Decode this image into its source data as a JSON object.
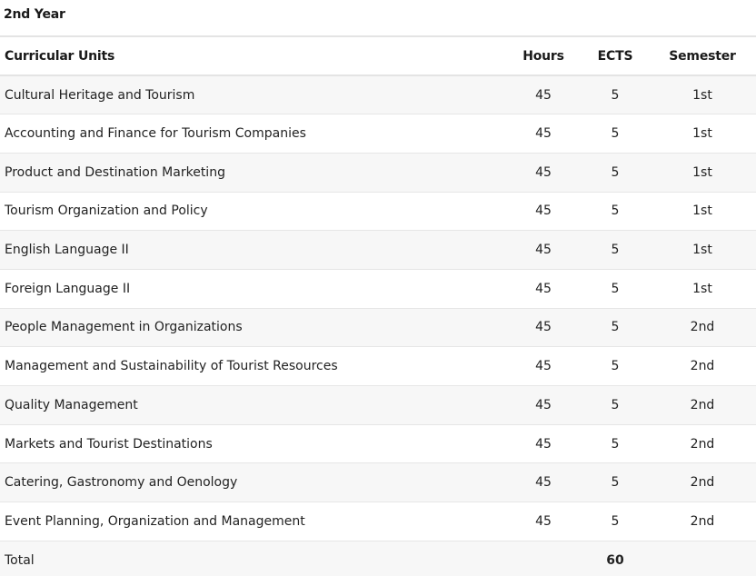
{
  "section_title": "2nd Year",
  "table": {
    "headers": {
      "unit": "Curricular Units",
      "hours": "Hours",
      "ects": "ECTS",
      "semester": "Semester"
    },
    "rows": [
      {
        "unit": "Cultural Heritage and Tourism",
        "hours": "45",
        "ects": "5",
        "semester": "1st"
      },
      {
        "unit": "Accounting and Finance for Tourism Companies",
        "hours": "45",
        "ects": "5",
        "semester": "1st"
      },
      {
        "unit": "Product and Destination Marketing",
        "hours": "45",
        "ects": "5",
        "semester": "1st"
      },
      {
        "unit": "Tourism Organization and Policy",
        "hours": "45",
        "ects": "5",
        "semester": "1st"
      },
      {
        "unit": "English Language II",
        "hours": "45",
        "ects": "5",
        "semester": "1st"
      },
      {
        "unit": "Foreign Language II",
        "hours": "45",
        "ects": "5",
        "semester": "1st"
      },
      {
        "unit": "People Management in Organizations",
        "hours": "45",
        "ects": "5",
        "semester": "2nd"
      },
      {
        "unit": "Management and Sustainability of Tourist Resources",
        "hours": "45",
        "ects": "5",
        "semester": "2nd"
      },
      {
        "unit": "Quality Management",
        "hours": "45",
        "ects": "5",
        "semester": "2nd"
      },
      {
        "unit": "Markets and Tourist Destinations",
        "hours": "45",
        "ects": "5",
        "semester": "2nd"
      },
      {
        "unit": "Catering, Gastronomy and Oenology",
        "hours": "45",
        "ects": "5",
        "semester": "2nd"
      },
      {
        "unit": "Event Planning, Organization and Management",
        "hours": "45",
        "ects": "5",
        "semester": "2nd"
      }
    ],
    "total": {
      "label": "Total",
      "ects": "60"
    }
  }
}
